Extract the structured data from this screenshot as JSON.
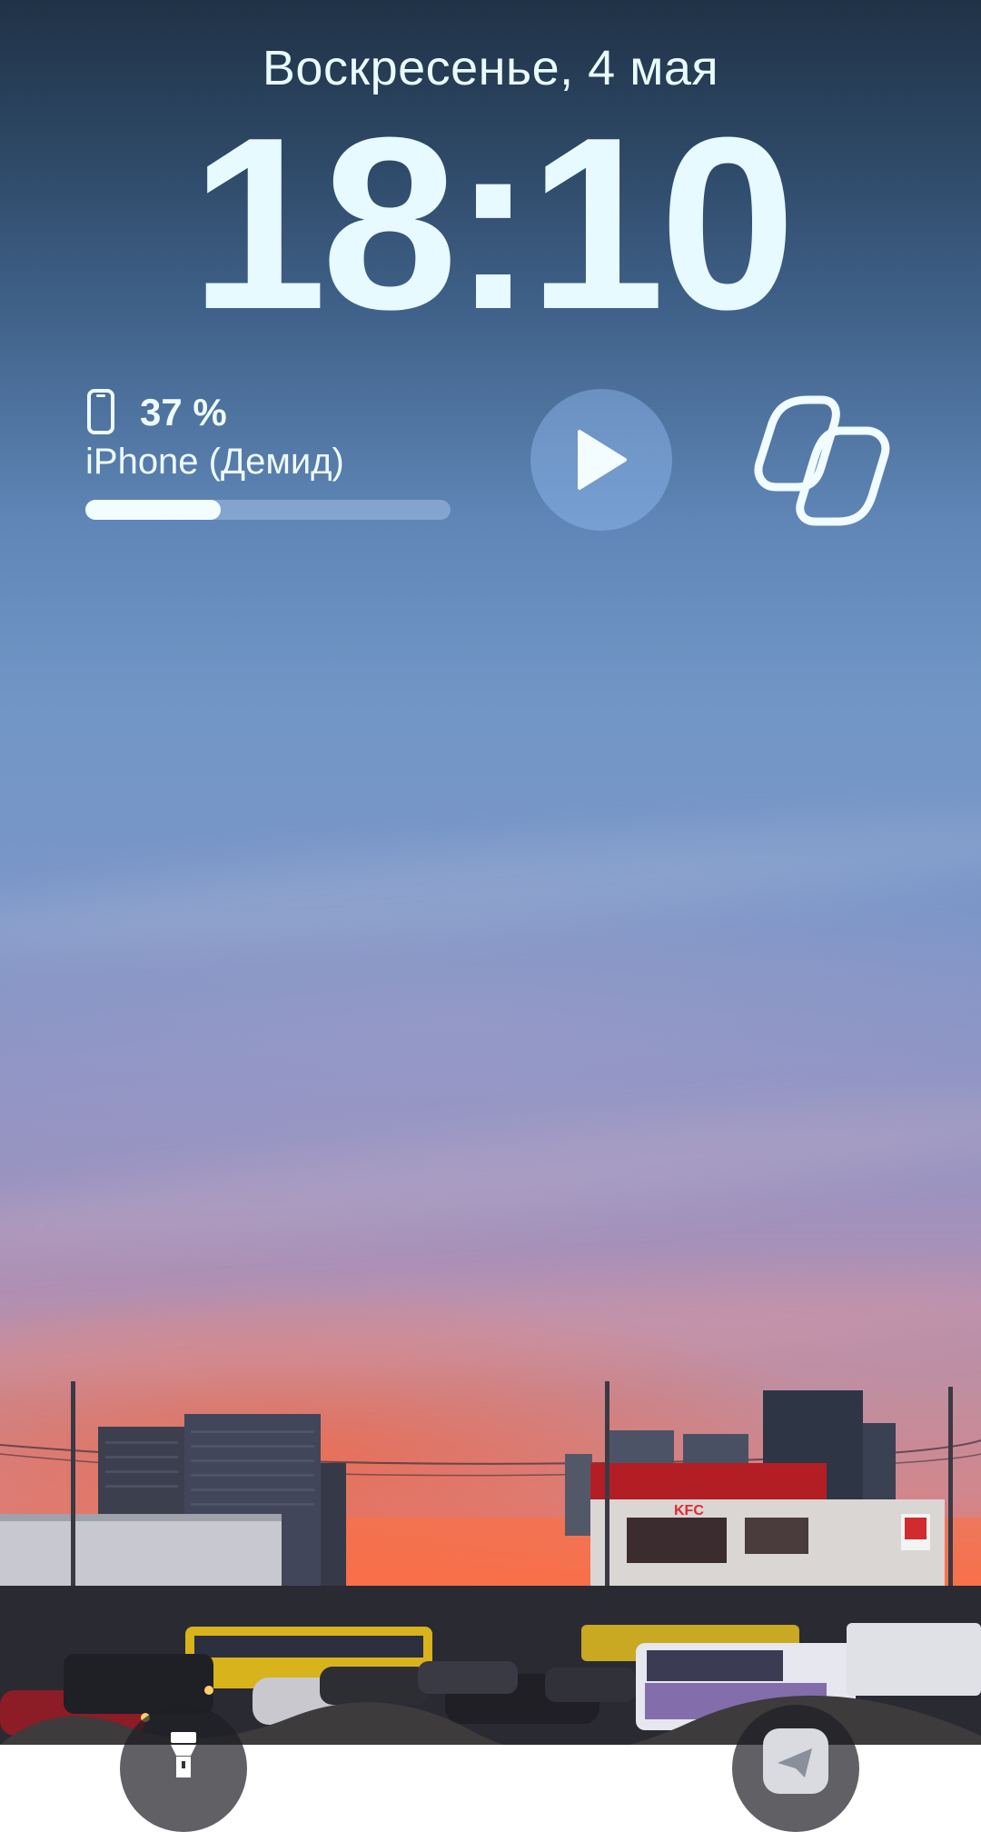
{
  "lockscreen": {
    "date": "Воскресенье, 4 мая",
    "time": "18:10"
  },
  "battery_widget": {
    "percent_label": "37 %",
    "level_fraction": 0.37,
    "device_name": "iPhone (Демид)",
    "icon": "iphone-outline-icon"
  },
  "media_widget": {
    "icon": "play-icon"
  },
  "app_widget": {
    "icon": "copilot-logo-icon"
  },
  "quick_actions": {
    "left_icon": "flashlight-icon",
    "right_icon": "app-shortcut-icon"
  },
  "wallpaper": {
    "sign_text": "KFC",
    "colors": {
      "sky_top": "#203246",
      "sky_mid": "#7196c6",
      "sunset": "#ff6a3a"
    }
  }
}
